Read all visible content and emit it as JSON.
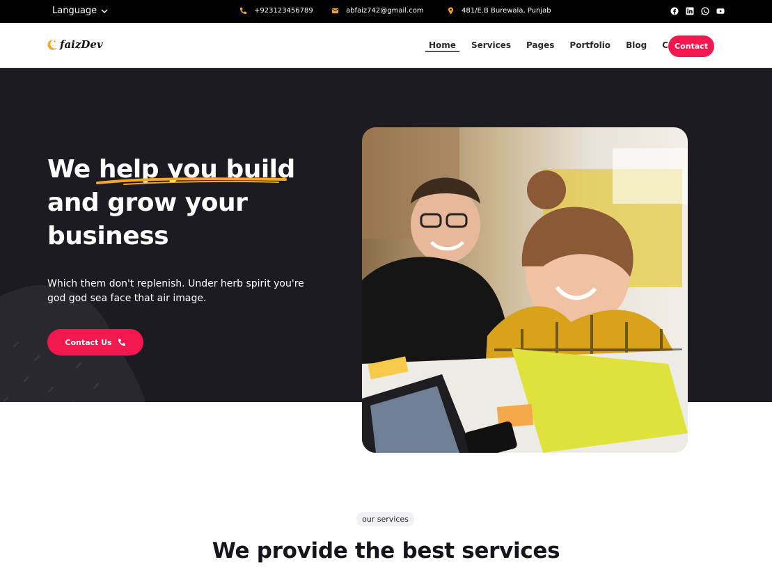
{
  "topbar": {
    "language_label": "Language",
    "phone": "+923123456789",
    "email": "abfaiz742@gmail.com",
    "address": "481/E.B Burewala, Punjab",
    "socials": [
      "facebook-icon",
      "linkedin-icon",
      "whatsapp-icon",
      "youtube-icon"
    ]
  },
  "header": {
    "logo_text": "faizDev",
    "nav": [
      "Home",
      "Services",
      "Pages",
      "Portfolio",
      "Blog",
      "Contact"
    ],
    "active_nav": "Home",
    "contact_button": "Contact"
  },
  "hero": {
    "title_part1": "We",
    "title_highlight": "help you build",
    "title_part2": "and grow your business",
    "description": "Which them don't replenish. Under herb spirit you're god god sea face that air image.",
    "cta_label": "Contact Us"
  },
  "services": {
    "badge": "our services",
    "title": "We provide the best services"
  },
  "colors": {
    "accent": "#f2184f",
    "hero_bg": "#1c1b21",
    "highlight_underline": "#f5a623",
    "topbar_bg": "#000000"
  }
}
